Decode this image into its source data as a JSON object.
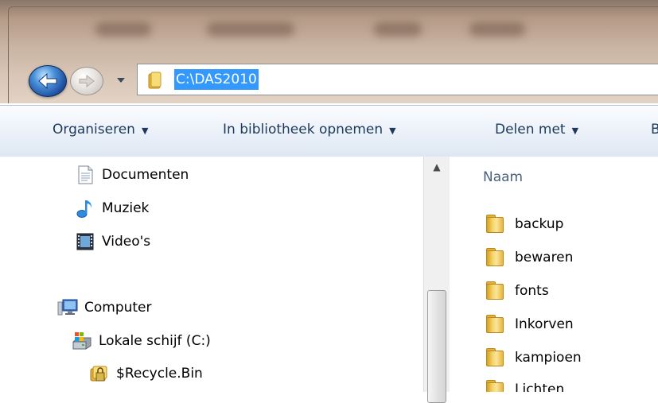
{
  "window": {
    "address_path": "C:\\DAS2010"
  },
  "toolbar": {
    "items": [
      {
        "label": "Organiseren"
      },
      {
        "label": "In bibliotheek opnemen"
      },
      {
        "label": "Delen met"
      },
      {
        "label": "B"
      }
    ]
  },
  "nav_pane": {
    "items": [
      {
        "label": "Documenten",
        "icon": "documents-icon"
      },
      {
        "label": "Muziek",
        "icon": "music-icon"
      },
      {
        "label": "Video's",
        "icon": "video-icon"
      },
      {
        "label": "Computer",
        "icon": "computer-icon"
      },
      {
        "label": "Lokale schijf (C:)",
        "icon": "local-disk-icon"
      },
      {
        "label": "$Recycle.Bin",
        "icon": "recycle-bin-icon"
      }
    ]
  },
  "file_pane": {
    "column_header": "Naam",
    "items": [
      {
        "name": "backup"
      },
      {
        "name": "bewaren"
      },
      {
        "name": "fonts"
      },
      {
        "name": "Inkorven"
      },
      {
        "name": "kampioen"
      },
      {
        "name": "Lichten"
      }
    ]
  },
  "colors": {
    "selection": "#3399ff",
    "toolbar_text": "#1e395b",
    "header_text": "#4c607a"
  }
}
